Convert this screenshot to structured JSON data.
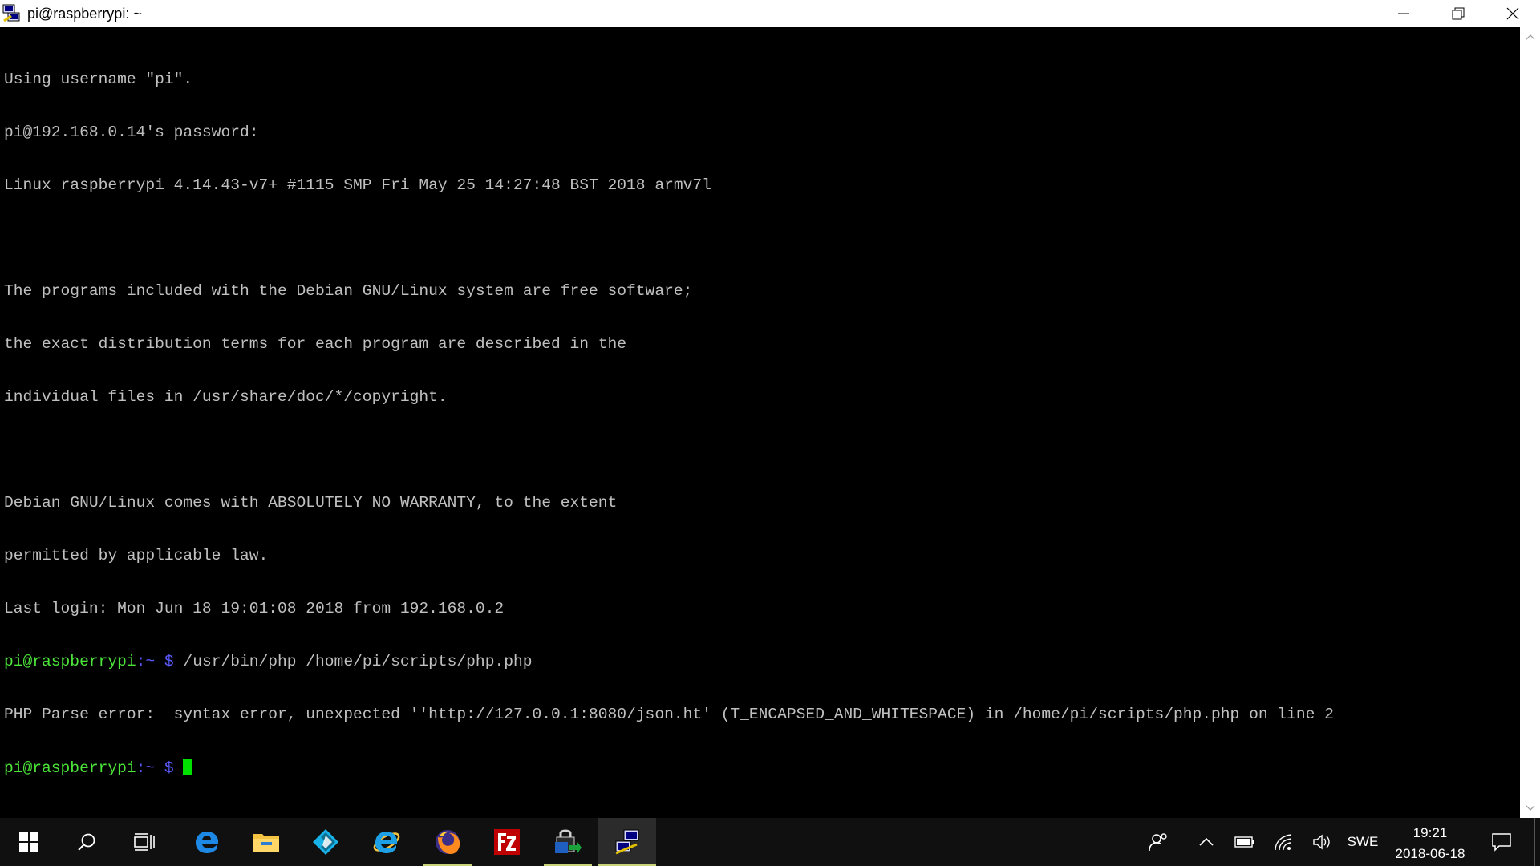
{
  "window": {
    "title": "pi@raspberrypi: ~",
    "icon": "putty-icon"
  },
  "window_controls": {
    "minimize": "minimize-icon",
    "restore": "restore-icon",
    "close": "close-icon"
  },
  "terminal": {
    "lines": [
      "Using username \"pi\".",
      "pi@192.168.0.14's password:",
      "Linux raspberrypi 4.14.43-v7+ #1115 SMP Fri May 25 14:27:48 BST 2018 armv7l",
      "",
      "The programs included with the Debian GNU/Linux system are free software;",
      "the exact distribution terms for each program are described in the",
      "individual files in /usr/share/doc/*/copyright.",
      "",
      "Debian GNU/Linux comes with ABSOLUTELY NO WARRANTY, to the extent",
      "permitted by applicable law.",
      "Last login: Mon Jun 18 19:01:08 2018 from 192.168.0.2"
    ],
    "command_line": {
      "user_host": "pi@raspberrypi",
      "path": ":~ $",
      "command": " /usr/bin/php /home/pi/scripts/php.php"
    },
    "error_line": "PHP Parse error:  syntax error, unexpected ''http://127.0.0.1:8080/json.ht' (T_ENCAPSED_AND_WHITESPACE) in /home/pi/scripts/php.php on line 2",
    "prompt": {
      "user_host": "pi@raspberrypi",
      "path": ":~ $"
    },
    "colors": {
      "prompt_user": "#4ce63a",
      "prompt_path": "#5a5aff",
      "text": "#c0c0c0",
      "cursor": "#00e000"
    }
  },
  "taskbar": {
    "apps": [
      {
        "name": "start-button",
        "icon": "windows-logo-icon"
      },
      {
        "name": "search-button",
        "icon": "search-icon"
      },
      {
        "name": "task-view-button",
        "icon": "task-view-icon"
      },
      {
        "name": "edge",
        "icon": "edge-icon"
      },
      {
        "name": "file-explorer",
        "icon": "folder-icon"
      },
      {
        "name": "kodi",
        "icon": "kodi-icon"
      },
      {
        "name": "internet-explorer",
        "icon": "ie-icon"
      },
      {
        "name": "firefox",
        "icon": "firefox-icon"
      },
      {
        "name": "filezilla",
        "icon": "filezilla-icon"
      },
      {
        "name": "vpn-app",
        "icon": "lock-network-icon"
      },
      {
        "name": "putty",
        "icon": "putty-icon"
      }
    ],
    "tray": {
      "people": "people-icon",
      "show_hidden": "chevron-up-icon",
      "battery": "battery-icon",
      "wifi": "wifi-icon",
      "volume": "volume-icon",
      "language": "SWE",
      "time": "19:21",
      "date": "2018-06-18",
      "notifications": "action-center-icon"
    }
  }
}
